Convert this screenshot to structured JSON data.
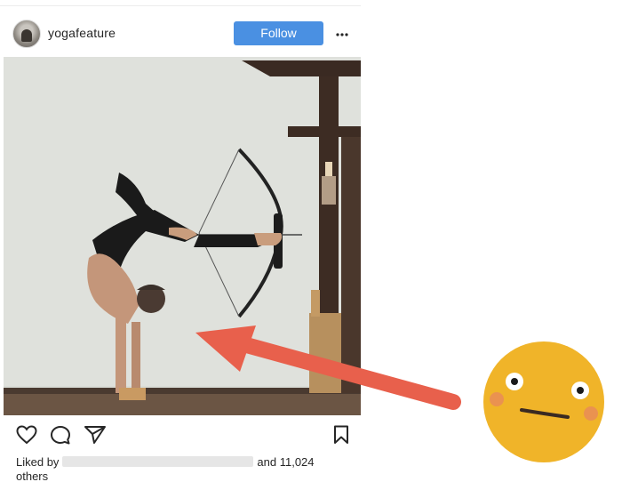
{
  "post": {
    "username": "yogafeature",
    "follow_label": "Follow",
    "likes_prefix": "Liked by",
    "likes_suffix": "and 11,024",
    "likes_suffix_line2": "others"
  },
  "icons": {
    "like": "heart-icon",
    "comment": "comment-icon",
    "share": "paper-plane-icon",
    "save": "bookmark-icon",
    "more": "more-icon",
    "overlay_emoji": "confused-face-emoji",
    "overlay_arrow": "red-arrow"
  },
  "colors": {
    "follow_button": "#4a90e2",
    "arrow": "#e8604c",
    "emoji_face": "#f0b429",
    "emoji_cheeks": "#e88a5a"
  }
}
